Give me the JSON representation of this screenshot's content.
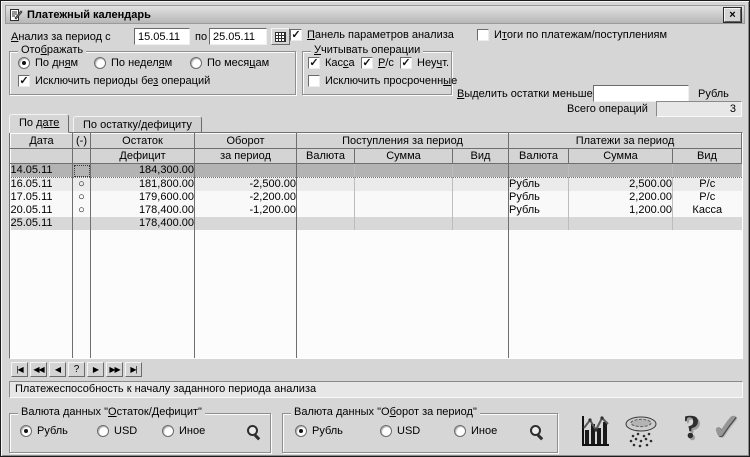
{
  "window": {
    "title": "Платежный календарь",
    "close_glyph": "×"
  },
  "period": {
    "label": "~А~нализ за период с",
    "date_from": "15.05.11",
    "to_label": "по",
    "date_to": "25.05.11"
  },
  "top_checkboxes": {
    "panel": {
      "label": "~П~анель параметров анализа",
      "checked": true
    },
    "totals": {
      "label": "И~т~оги по платежам/поступлениям",
      "checked": false
    }
  },
  "display_group": {
    "title": "Ото~б~ражать",
    "radios": [
      {
        "label": "По дн~я~м",
        "selected": true
      },
      {
        "label": "По недел~я~м",
        "selected": false
      },
      {
        "label": "По меся~ц~ам",
        "selected": false
      }
    ],
    "exclude_empty": {
      "label": "Исключить периоды бе~з~ операций",
      "checked": true
    }
  },
  "operations_group": {
    "title": "~У~читывать операции",
    "checkboxes": [
      {
        "label": "Кас~с~а",
        "checked": true
      },
      {
        "label": "~Р~/с",
        "checked": true
      },
      {
        "label": "Неу~ч~т.",
        "checked": true
      }
    ],
    "overdue": {
      "label": "Исключить просроченн~ы~е",
      "checked": false
    }
  },
  "highlight": {
    "label": "~В~ыделить остатки меньше",
    "value": "",
    "currency": "Рубль"
  },
  "total_ops": {
    "label": "Всего операций",
    "value": "3"
  },
  "tabs": [
    {
      "label": "По ~дате~",
      "active": true
    },
    {
      "label": "По остатку/дефициту",
      "active": false
    }
  ],
  "table": {
    "header": {
      "date": "Дата",
      "minus": "(-)",
      "balance_line1": "Остаток",
      "balance_line2": "Дефицит",
      "turnover_line1": "Оборот",
      "turnover_line2": "за период",
      "income_group": "Поступления за период",
      "payment_group": "Платежи за период",
      "currency": "Валюта",
      "sum": "Сумма",
      "kind": "Вид"
    },
    "rows": [
      {
        "date": "14.05.11",
        "marker": "",
        "balance": "184,300.00",
        "turnover": "",
        "in_cur": "",
        "in_sum": "",
        "in_kind": "",
        "pay_cur": "",
        "pay_sum": "",
        "pay_kind": "",
        "state": "selected"
      },
      {
        "date": "16.05.11",
        "marker": "○",
        "balance": "181,800.00",
        "turnover": "-2,500.00",
        "in_cur": "",
        "in_sum": "",
        "in_kind": "",
        "pay_cur": "Рубль",
        "pay_sum": "2,500.00",
        "pay_kind": "Р/с",
        "state": "normal"
      },
      {
        "date": "17.05.11",
        "marker": "○",
        "balance": "179,600.00",
        "turnover": "-2,200.00",
        "in_cur": "",
        "in_sum": "",
        "in_kind": "",
        "pay_cur": "Рубль",
        "pay_sum": "2,200.00",
        "pay_kind": "Р/с",
        "state": "normal"
      },
      {
        "date": "20.05.11",
        "marker": "○",
        "balance": "178,400.00",
        "turnover": "-1,200.00",
        "in_cur": "",
        "in_sum": "",
        "in_kind": "",
        "pay_cur": "Рубль",
        "pay_sum": "1,200.00",
        "pay_kind": "Касса",
        "state": "normal"
      },
      {
        "date": "25.05.11",
        "marker": "",
        "balance": "178,400.00",
        "turnover": "",
        "in_cur": "",
        "in_sum": "",
        "in_kind": "",
        "pay_cur": "",
        "pay_sum": "",
        "pay_kind": "",
        "state": "total"
      }
    ]
  },
  "nav_buttons": [
    "|◀",
    "◀◀",
    "◀",
    "?",
    "▶",
    "▶▶",
    "▶|"
  ],
  "status_text": "Платежеспособность к началу заданного периода анализа",
  "balance_currency_group": {
    "title": "Валюта данных \"~О~статок/Дефицит\"",
    "radios": [
      {
        "label": "Рубль",
        "selected": true
      },
      {
        "label": "USD",
        "selected": false
      },
      {
        "label": "Иное",
        "selected": false
      }
    ]
  },
  "turnover_currency_group": {
    "title": "Валюта данных \"О~б~орот за период\"",
    "radios": [
      {
        "label": "Рубль",
        "selected": true
      },
      {
        "label": "USD",
        "selected": false
      },
      {
        "label": "Иное",
        "selected": false
      }
    ]
  },
  "glyphs": {
    "checkmark": "✓",
    "help": "?",
    "confirm": "✓"
  }
}
